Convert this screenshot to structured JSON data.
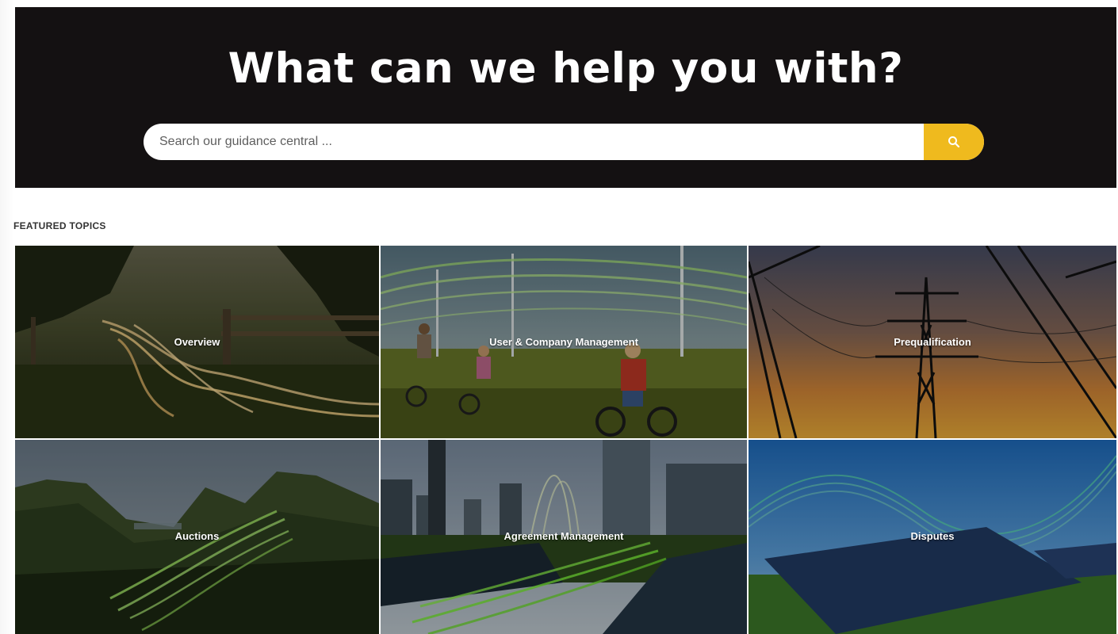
{
  "hero": {
    "title": "What can we help you with?",
    "search_placeholder": "Search our guidance central ...",
    "search_icon": "search-icon"
  },
  "featured": {
    "label": "FEATURED TOPICS",
    "topics": [
      {
        "label": "Overview"
      },
      {
        "label": "User & Company Management"
      },
      {
        "label": "Prequalification"
      },
      {
        "label": "Auctions"
      },
      {
        "label": "Agreement Management"
      },
      {
        "label": "Disputes"
      }
    ]
  },
  "colors": {
    "hero_bg": "#141112",
    "accent": "#efba1e",
    "glow_green": "#9be04a"
  }
}
